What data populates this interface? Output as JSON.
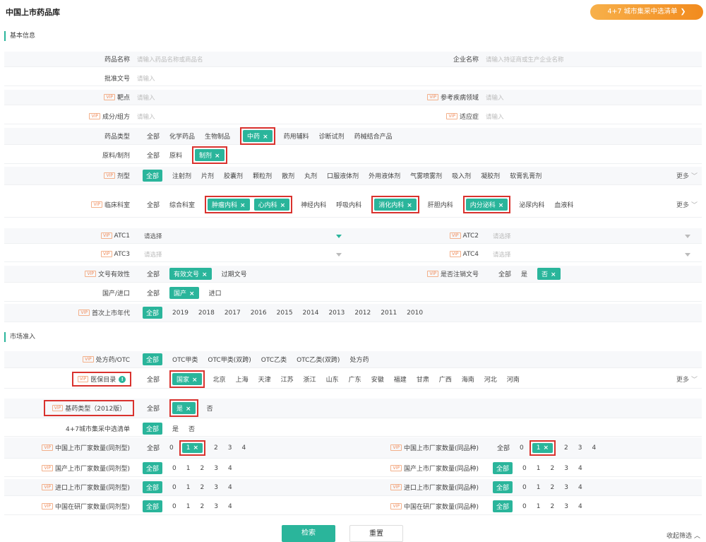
{
  "page_title": "中国上市药品库",
  "top_button": {
    "label": "4+7 城市集采中选清单",
    "icon": "chevron-right-icon",
    "color_from": "#f7b04a",
    "color_to": "#f28b1e"
  },
  "accent_color": "#2ab59b",
  "sections": {
    "basic": "基本信息",
    "market": "市场准入"
  },
  "fields": {
    "drug_name": {
      "label": "药品名称",
      "placeholder": "请输入药品名称或商品名"
    },
    "company_name": {
      "label": "企业名称",
      "placeholder": "请输入持证商或生产企业名称"
    },
    "approval_no": {
      "label": "批准文号",
      "placeholder": "请输入"
    },
    "target": {
      "label": "靶点",
      "placeholder": "请输入"
    },
    "ref_disease": {
      "label": "参考疾病领域",
      "placeholder": "请输入"
    },
    "ingredient": {
      "label": "成分/组方",
      "placeholder": "请输入"
    },
    "indication": {
      "label": "适应症",
      "placeholder": "请输入"
    },
    "atc1": {
      "label": "ATC1",
      "placeholder": "请选择"
    },
    "atc2": {
      "label": "ATC2",
      "placeholder": "请选择"
    },
    "atc3": {
      "label": "ATC3",
      "placeholder": "请选择"
    },
    "atc4": {
      "label": "ATC4",
      "placeholder": "请选择"
    }
  },
  "vip_label": "VIP",
  "all_label": "全部",
  "more_label": "更多",
  "drug_type": {
    "label": "药品类型",
    "before": [
      "化学药品",
      "生物制品"
    ],
    "selected": "中药",
    "after": [
      "药用辅料",
      "诊断试剂",
      "药械结合产品"
    ]
  },
  "raw_prep": {
    "label": "原料/制剂",
    "before": [
      "原料"
    ],
    "selected": "制剂"
  },
  "dosage_form": {
    "label": "剂型",
    "options": [
      "注射剂",
      "片剂",
      "胶囊剂",
      "颗粒剂",
      "散剂",
      "丸剂",
      "口服液体剂",
      "外用液体剂",
      "气雾喷雾剂",
      "吸入剂",
      "凝胶剂",
      "软膏乳膏剂"
    ]
  },
  "clinical_dept": {
    "label": "临床科室",
    "opt1": "综合科室",
    "sel1": "肿瘤内科",
    "sel2": "心内科",
    "opt2": "神经内科",
    "opt3": "呼吸内科",
    "sel3": "消化内科",
    "opt4": "肝胆内科",
    "sel4": "内分泌科",
    "opt5": "泌尿内科",
    "opt6": "血液科"
  },
  "doc_validity": {
    "label": "文号有效性",
    "selected": "有效文号",
    "after": [
      "过期文号"
    ]
  },
  "cancelled_doc": {
    "label": "是否注销文号",
    "opt_yes": "是",
    "selected": "否"
  },
  "domestic_import": {
    "label": "国产/进口",
    "selected": "国产",
    "after": [
      "进口"
    ]
  },
  "first_year": {
    "label": "首次上市年代",
    "years": [
      "2019",
      "2018",
      "2017",
      "2016",
      "2015",
      "2014",
      "2013",
      "2012",
      "2011",
      "2010"
    ]
  },
  "rx_otc": {
    "label": "处方药/OTC",
    "options": [
      "OTC甲类",
      "OTC甲类(双跨)",
      "OTC乙类",
      "OTC乙类(双跨)",
      "处方药"
    ]
  },
  "insurance": {
    "label": "医保目录",
    "icon": "info-icon",
    "selected": "国家",
    "regions": [
      "北京",
      "上海",
      "天津",
      "江苏",
      "浙江",
      "山东",
      "广东",
      "安徽",
      "福建",
      "甘肃",
      "广西",
      "海南",
      "河北",
      "河南"
    ]
  },
  "essential_drug": {
    "label": "基药类型（2012版）",
    "selected": "是",
    "after": [
      "否"
    ]
  },
  "procurement": {
    "label": "4+7城市集采中选清单",
    "options": [
      "是",
      "否"
    ]
  },
  "counts": {
    "cn_listed_form": {
      "label": "中国上市厂家数量(同剂型)",
      "before": [
        "0"
      ],
      "selected": "1",
      "after": [
        "2",
        "3",
        "4"
      ]
    },
    "cn_listed_variety": {
      "label": "中国上市厂家数量(同品种)",
      "before": [
        "0"
      ],
      "selected": "1",
      "after": [
        "2",
        "3",
        "4"
      ]
    },
    "dom_listed_form": {
      "label": "国产上市厂家数量(同剂型)",
      "options": [
        "0",
        "1",
        "2",
        "3",
        "4"
      ]
    },
    "dom_listed_variety": {
      "label": "国产上市厂家数量(同品种)",
      "options": [
        "0",
        "1",
        "2",
        "3",
        "4"
      ]
    },
    "imp_listed_form": {
      "label": "进口上市厂家数量(同剂型)",
      "options": [
        "0",
        "1",
        "2",
        "3",
        "4"
      ]
    },
    "imp_listed_variety": {
      "label": "进口上市厂家数量(同品种)",
      "options": [
        "0",
        "1",
        "2",
        "3",
        "4"
      ]
    },
    "cn_dev_form": {
      "label": "中国在研厂家数量(同剂型)",
      "options": [
        "0",
        "1",
        "2",
        "3",
        "4"
      ]
    },
    "cn_dev_variety": {
      "label": "中国在研厂家数量(同品种)",
      "options": [
        "0",
        "1",
        "2",
        "3",
        "4"
      ]
    }
  },
  "actions": {
    "search": "检索",
    "reset": "重置",
    "collapse": "收起筛选"
  }
}
